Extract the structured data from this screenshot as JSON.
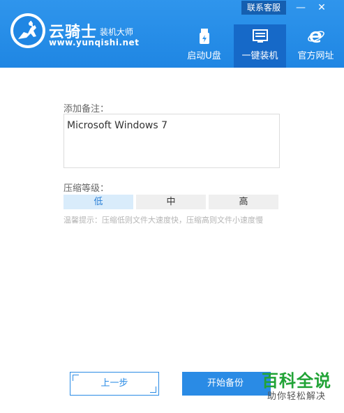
{
  "header": {
    "brand_name": "云骑士",
    "brand_suffix": "装机大师",
    "brand_url": "www.yunqishi.net",
    "contact_label": "联系客服",
    "minimize_glyph": "—",
    "close_glyph": "✕"
  },
  "nav": [
    {
      "label": "启动U盘",
      "icon": "usb-drive-icon",
      "active": false
    },
    {
      "label": "一键装机",
      "icon": "install-screen-icon",
      "active": true
    },
    {
      "label": "官方网址",
      "icon": "ie-browser-icon",
      "active": false
    }
  ],
  "form": {
    "remark_label": "添加备注：",
    "remark_value": "Microsoft Windows 7",
    "compression_label": "压缩等级：",
    "levels": [
      {
        "label": "低",
        "selected": true
      },
      {
        "label": "中",
        "selected": false
      },
      {
        "label": "高",
        "selected": false
      }
    ],
    "tip": "温馨提示：压缩低则文件大速度快，压缩高则文件小速度慢"
  },
  "footer": {
    "prev_label": "上一步",
    "start_label": "开始备份"
  },
  "watermark": {
    "main": "百科全说",
    "sub": "助你轻松解决"
  },
  "colors": {
    "header": "#1f86e3",
    "nav_active": "#1669c8",
    "accent": "#2a8be5",
    "watermark_green": "#21a336"
  }
}
